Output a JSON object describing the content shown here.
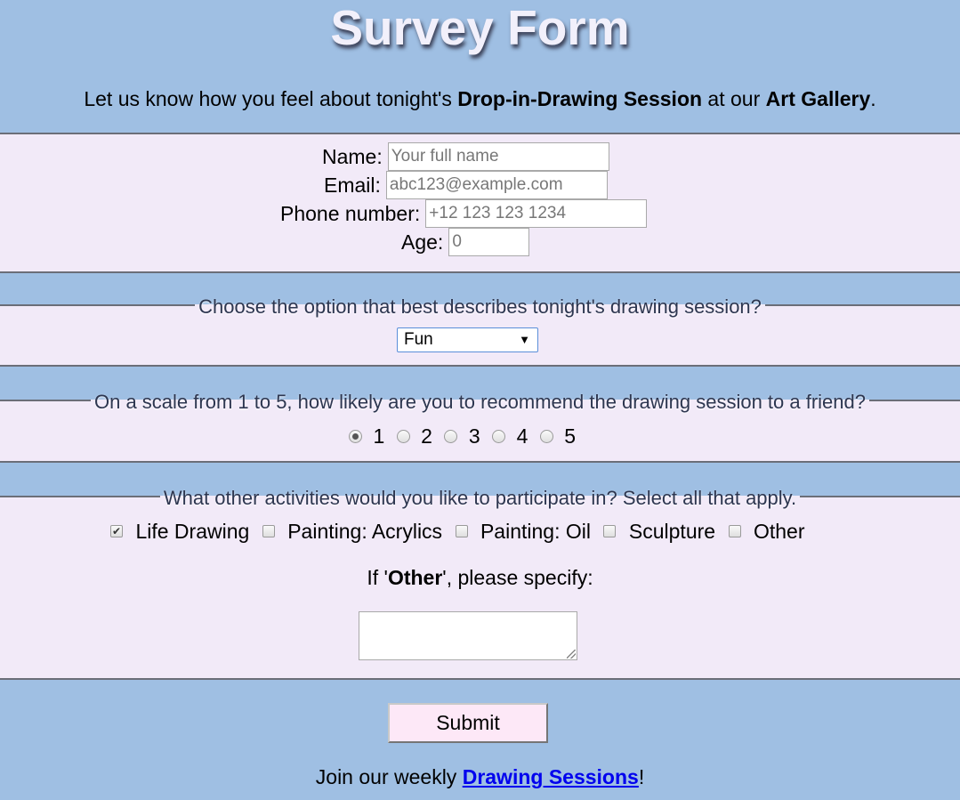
{
  "header": {
    "title": "Survey Form",
    "intro_prefix": "Let us know how you feel about tonight's ",
    "intro_session": "Drop-in-Drawing Session",
    "intro_middle": " at our ",
    "intro_gallery": "Art Gallery",
    "intro_suffix": "."
  },
  "personal": {
    "name_label": "Name:",
    "name_placeholder": "Your full name",
    "email_label": "Email:",
    "email_placeholder": "abc123@example.com",
    "phone_label": "Phone number:",
    "phone_placeholder": "+12 123 123 1234",
    "age_label": "Age:",
    "age_placeholder": "0"
  },
  "session_question": {
    "legend": "Choose the option that best describes tonight's drawing session?",
    "selected": "Fun",
    "arrow": "▼"
  },
  "recommend_question": {
    "legend": "On a scale from 1 to 5, how likely are you to recommend the drawing session to a friend?",
    "options": [
      "1",
      "2",
      "3",
      "4",
      "5"
    ],
    "selected": "1"
  },
  "activities_question": {
    "legend": "What other activities would you like to participate in? Select all that apply.",
    "options": [
      "Life Drawing",
      "Painting: Acrylics",
      "Painting: Oil",
      "Sculpture",
      "Other"
    ],
    "checked": [
      "Life Drawing"
    ],
    "check_mark": "✔",
    "other_prefix": "If '",
    "other_word": "Other",
    "other_suffix": "', please specify:"
  },
  "submit": {
    "label": "Submit"
  },
  "footer": {
    "prefix": "Join our weekly ",
    "link": "Drawing Sessions",
    "suffix": "!"
  }
}
